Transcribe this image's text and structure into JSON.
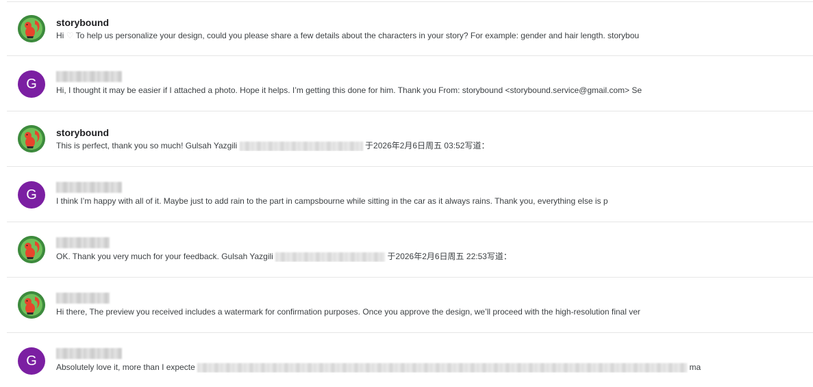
{
  "messages": [
    {
      "sender": "storybound",
      "avatar": "squirrel-avatar",
      "snippet_before": "Hi",
      "snippet_icon": "heart-icon",
      "snippet_after": "To help us personalize your design, could you please share a few details about the characters in your story? For example: gender and hair length. storybou"
    },
    {
      "sender": "",
      "avatar_letter": "G",
      "snippet": "Hi, I thought it may be easier if I attached a photo. Hope it helps. I’m getting this done for him. Thank you From: storybound <storybound.service@gmail.com> Se"
    },
    {
      "sender": "storybound",
      "avatar": "squirrel-avatar",
      "snippet_before": "This is perfect, thank you so much! Gulsah Yazgili",
      "snippet_after": "于2026年2月6日周五 03:52写道："
    },
    {
      "sender": "",
      "avatar_letter": "G",
      "snippet": "I think I’m happy with all of it. Maybe just to add rain to the part in campsbourne while sitting in the car as it always rains. Thank you, everything else is p"
    },
    {
      "sender": "",
      "avatar": "squirrel-avatar",
      "snippet_before": "OK. Thank you very much for your feedback. Gulsah Yazgili",
      "snippet_after": "于2026年2月6日周五 22:53写道："
    },
    {
      "sender": "",
      "avatar": "squirrel-avatar",
      "snippet": "Hi there, The preview you received includes a watermark for confirmation purposes. Once you approve the design, we’ll proceed with the high-resolution final ver"
    },
    {
      "sender": "",
      "avatar_letter": "G",
      "snippet_before": "Absolutely love it, more than I expecte",
      "snippet_after": "ma"
    }
  ],
  "colors": {
    "letter_avatar_bg": "#7b1fa2",
    "divider": "#e6e6e6",
    "sender_text": "#202124",
    "snippet_text": "#3c4043"
  }
}
